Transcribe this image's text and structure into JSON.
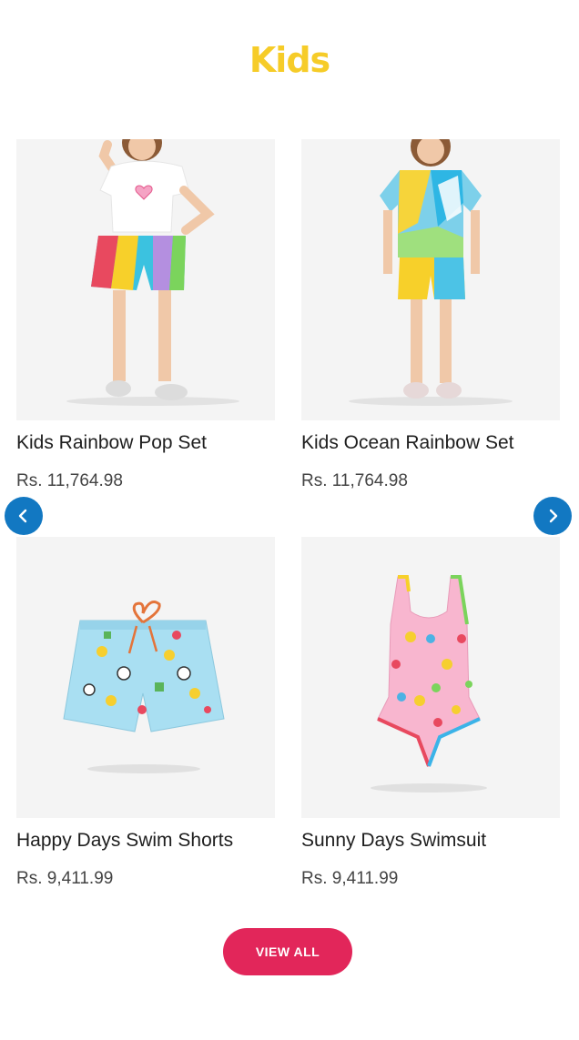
{
  "section": {
    "title": "Kids"
  },
  "products": [
    {
      "name": "Kids Rainbow Pop Set",
      "price": "Rs. 11,764.98"
    },
    {
      "name": "Kids Ocean Rainbow Set",
      "price": "Rs. 11,764.98"
    },
    {
      "name": "Happy Days Swim Shorts",
      "price": "Rs. 9,411.99"
    },
    {
      "name": "Sunny Days Swimsuit",
      "price": "Rs. 9,411.99"
    }
  ],
  "carousel": {
    "prev_icon": "chevron-left-icon",
    "next_icon": "chevron-right-icon"
  },
  "cta": {
    "view_all": "VIEW ALL"
  },
  "colors": {
    "title": "#f6cc28",
    "nav": "#1278c2",
    "button": "#e2265a",
    "image_bg": "#f4f4f4"
  }
}
